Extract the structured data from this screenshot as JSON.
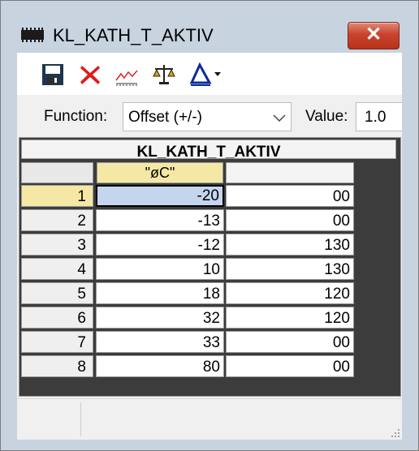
{
  "window": {
    "title": "KL_KATH_T_AKTIV",
    "close_label": "✕"
  },
  "toolbar": {
    "buttons": [
      {
        "name": "save-icon",
        "label": "Save"
      },
      {
        "name": "delete-icon",
        "label": "Delete"
      },
      {
        "name": "chart-icon",
        "label": "Graph"
      },
      {
        "name": "balance-icon",
        "label": "Balance"
      },
      {
        "name": "triangle-dropdown-icon",
        "label": "Options"
      }
    ]
  },
  "function_bar": {
    "function_label": "Function:",
    "function_value": "Offset (+/-)",
    "value_label": "Value:",
    "value_value": "1.0"
  },
  "table": {
    "title": "KL_KATH_T_AKTIV",
    "columns": [
      "\"øC\"",
      ""
    ],
    "rows": [
      {
        "index": "1",
        "c1": "-20",
        "c2": "00"
      },
      {
        "index": "2",
        "c1": "-13",
        "c2": "00"
      },
      {
        "index": "3",
        "c1": "-12",
        "c2": "130"
      },
      {
        "index": "4",
        "c1": "10",
        "c2": "130"
      },
      {
        "index": "5",
        "c1": "18",
        "c2": "120"
      },
      {
        "index": "6",
        "c1": "32",
        "c2": "120"
      },
      {
        "index": "7",
        "c1": "33",
        "c2": "00"
      },
      {
        "index": "8",
        "c1": "80",
        "c2": "00"
      }
    ]
  },
  "colors": {
    "title_bg": "#c8d3e0",
    "close_red": "#c9432c",
    "selected_cell": "#c5d5ee",
    "selected_header": "#f4e8a4",
    "grid_dark": "#3c3c3c"
  }
}
